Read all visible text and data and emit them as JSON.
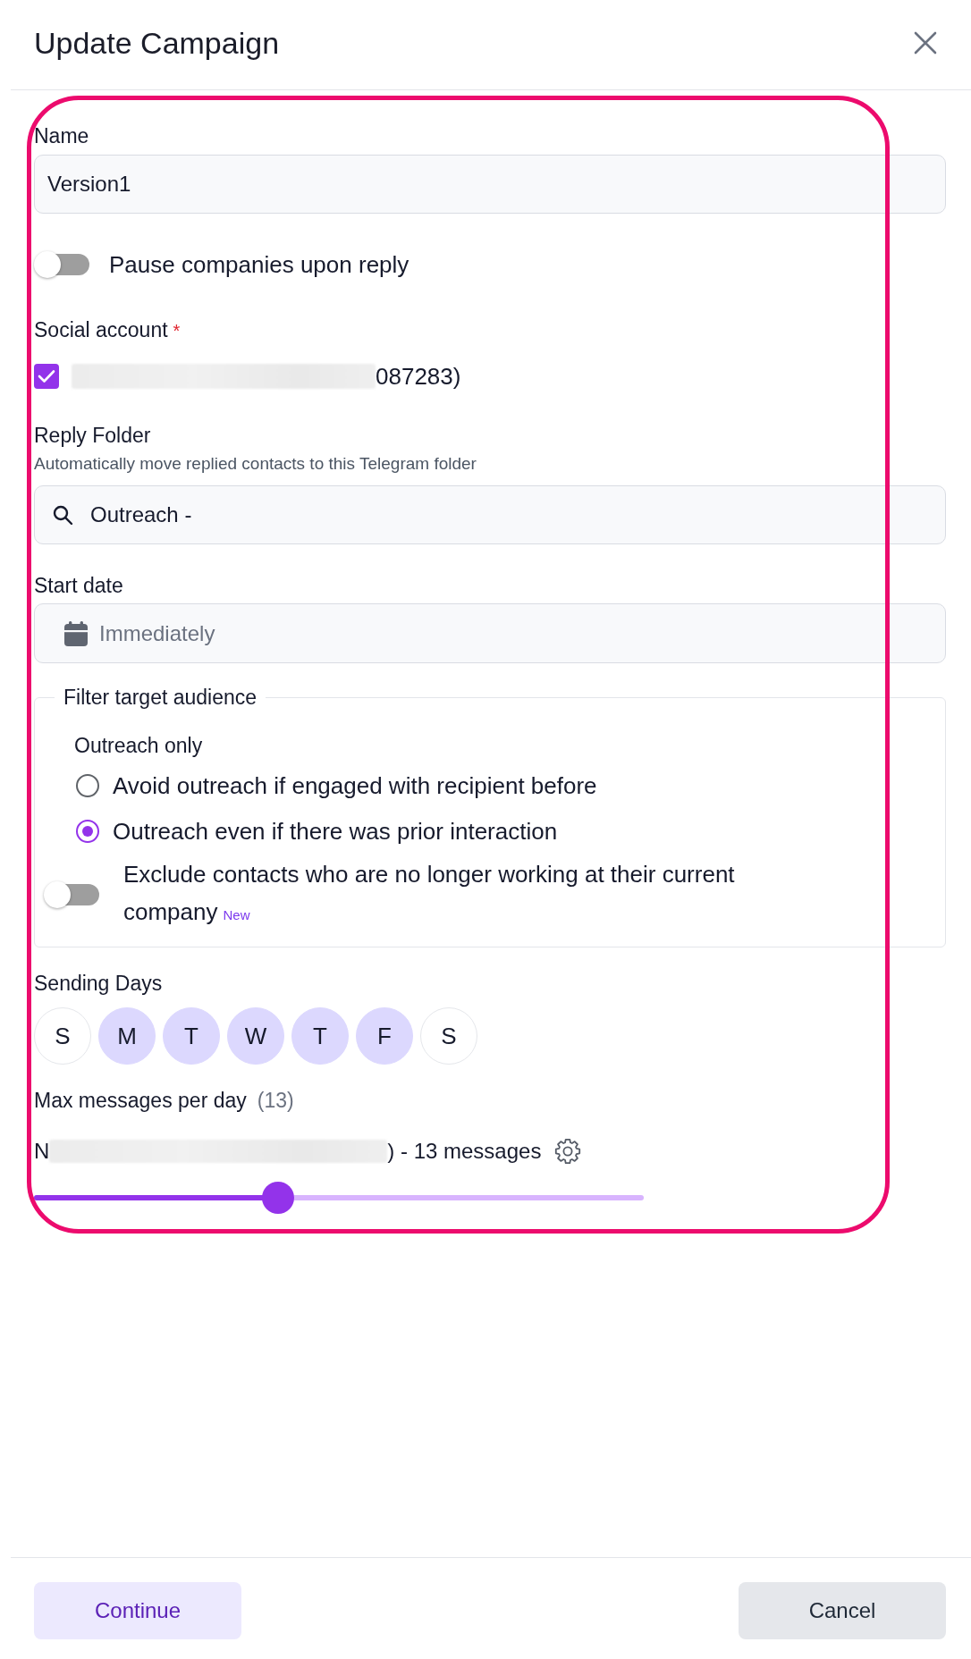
{
  "header": {
    "title": "Update Campaign"
  },
  "name_field": {
    "label": "Name",
    "value": "Version1"
  },
  "pause_toggle": {
    "label": "Pause companies upon reply",
    "on": false
  },
  "social_account": {
    "label": "Social account",
    "required_mark": "*",
    "accounts": [
      {
        "label": "087283)",
        "checked": true
      }
    ]
  },
  "reply_folder": {
    "label": "Reply Folder",
    "hint": "Automatically move replied contacts to this Telegram folder",
    "value": "Outreach -"
  },
  "start_date": {
    "label": "Start date",
    "placeholder": "Immediately"
  },
  "filter": {
    "legend": "Filter target audience",
    "group_label": "Outreach only",
    "options": [
      {
        "label": "Avoid outreach if engaged with recipient before",
        "selected": false
      },
      {
        "label": "Outreach even if there was prior interaction",
        "selected": true
      }
    ],
    "exclude_toggle": {
      "label": "Exclude contacts who are no longer working at their current company",
      "badge": "New",
      "on": false
    }
  },
  "sending_days": {
    "label": "Sending Days",
    "days": [
      {
        "label": "S",
        "selected": false
      },
      {
        "label": "M",
        "selected": true
      },
      {
        "label": "T",
        "selected": true
      },
      {
        "label": "W",
        "selected": true
      },
      {
        "label": "T",
        "selected": true
      },
      {
        "label": "F",
        "selected": true
      },
      {
        "label": "S",
        "selected": false
      }
    ]
  },
  "max_messages": {
    "label": "Max messages per day",
    "count": "(13)",
    "account_line": {
      "prefix": "N",
      "suffix": ") - 13 messages"
    },
    "slider": {
      "level": 0.4
    }
  },
  "footer": {
    "buttons": [
      {
        "label": "Continue",
        "kind": "confirm"
      },
      {
        "label": "Cancel",
        "kind": "dismiss"
      }
    ]
  }
}
